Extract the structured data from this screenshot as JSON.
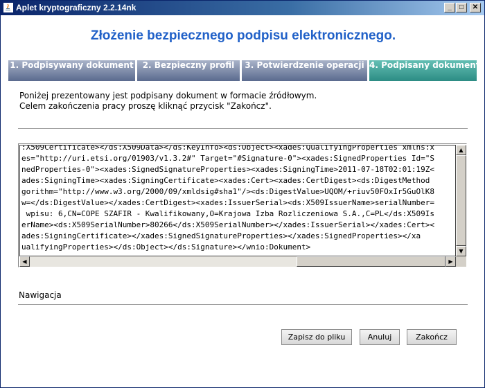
{
  "window": {
    "title": "Aplet kryptograficzny 2.2.14nk",
    "min_glyph": "_",
    "max_glyph": "□",
    "close_glyph": "✕"
  },
  "heading": "Złożenie bezpiecznego podpisu elektronicznego.",
  "tabs": [
    {
      "label": "1. Podpisywany dokument",
      "active": false
    },
    {
      "label": "2. Bezpieczny profil",
      "active": false
    },
    {
      "label": "3. Potwierdzenie operacji",
      "active": false
    },
    {
      "label": "4. Podpisany dokument",
      "active": true
    }
  ],
  "intro": {
    "line1": "Poniżej prezentowany jest podpisany dokument w formacie źródłowym.",
    "line2": "Celem zakończenia pracy proszę kliknąć przycisk \"Zakończ\"."
  },
  "code_lines": [
    ":X509Certificate></ds:X509Data></ds:KeyInfo><ds:Object><xades:QualifyingProperties xmlns:x",
    "es=\"http://uri.etsi.org/01903/v1.3.2#\" Target=\"#Signature-0\"><xades:SignedProperties Id=\"S",
    "nedProperties-0\"><xades:SignedSignatureProperties><xades:SigningTime>2011-07-18T02:01:19Z<",
    "ades:SigningTime><xades:SigningCertificate><xades:Cert><xades:CertDigest><ds:DigestMethod",
    "gorithm=\"http://www.w3.org/2000/09/xmldsig#sha1\"/><ds:DigestValue>UQOM/+riuv50FOxIr5GuOlK8",
    "w=</ds:DigestValue></xades:CertDigest><xades:IssuerSerial><ds:X509IssuerName>serialNumber=",
    " wpisu: 6,CN=COPE SZAFIR - Kwalifikowany,O=Krajowa Izba Rozliczeniowa S.A.,C=PL</ds:X509Is",
    "erName><ds:X509SerialNumber>80266</ds:X509SerialNumber></xades:IssuerSerial></xades:Cert><",
    "ades:SigningCertificate></xades:SignedSignatureProperties></xades:SignedProperties></xa",
    "ualifyingProperties></ds:Object></ds:Signature></wnio:Dokument>"
  ],
  "scroll": {
    "up": "▲",
    "down": "▼",
    "left": "◀",
    "right": "▶"
  },
  "navigation_label": "Nawigacja",
  "buttons": {
    "save": "Zapisz do pliku",
    "cancel": "Anuluj",
    "finish": "Zakończ"
  }
}
